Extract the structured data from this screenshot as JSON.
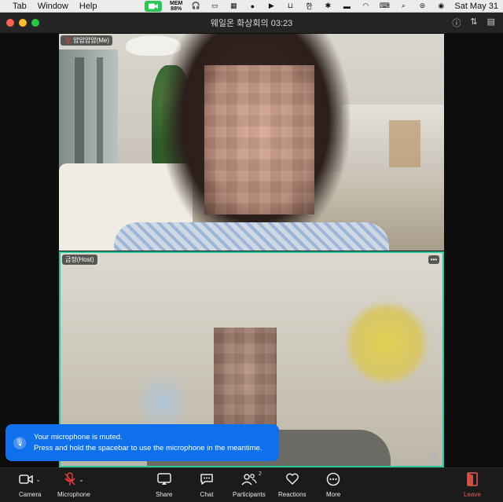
{
  "menubar": {
    "items": [
      "Tab",
      "Window",
      "Help"
    ],
    "mem_label": "MEM",
    "mem_value": "88%",
    "clock": "Sat May 31"
  },
  "window": {
    "title": "웨일온 화상회의 03:23",
    "traffic_colors": [
      "#ff5f57",
      "#febc2e",
      "#28c840"
    ]
  },
  "participants": [
    {
      "name": "얍얍얍얍(Me)",
      "muted": true
    },
    {
      "name": "금정(Host)",
      "muted": false,
      "active_speaker": true
    }
  ],
  "toast": {
    "line1": "Your microphone is muted.",
    "line2": "Press and hold the spacebar to use the microphone in the meantime."
  },
  "toolbar": {
    "camera": "Camera",
    "microphone": "Microphone",
    "share": "Share",
    "chat": "Chat",
    "participants": "Participants",
    "participants_count": "2",
    "reactions": "Reactions",
    "more": "More",
    "leave": "Leave"
  },
  "colors": {
    "accent": "#0e71eb",
    "speaker_border": "#27c99a",
    "leave": "#e85a4f",
    "mute": "#e53b3b"
  }
}
